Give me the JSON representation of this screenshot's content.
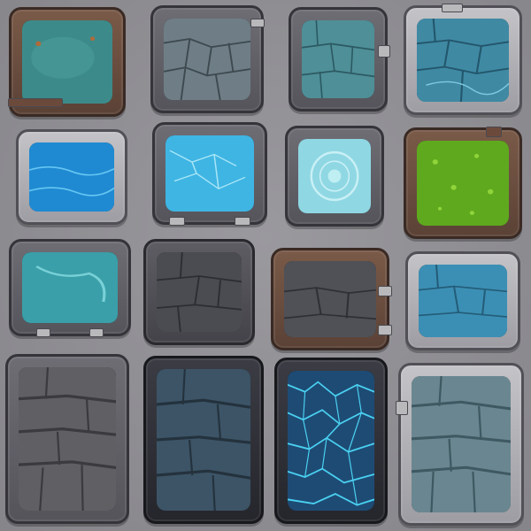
{
  "sheet": {
    "tiles": [
      {
        "id": "t1",
        "frame": "wood",
        "fill": "murky-water",
        "color": "#3c8b8a"
      },
      {
        "id": "t2",
        "frame": "stone",
        "fill": "stone-floor",
        "color": "#6f7e86"
      },
      {
        "id": "t3",
        "frame": "stone",
        "fill": "teal-stone",
        "color": "#4f8f97"
      },
      {
        "id": "t4",
        "frame": "steel",
        "fill": "blue-stone",
        "color": "#3f89a3"
      },
      {
        "id": "t5",
        "frame": "steel",
        "fill": "deep-water",
        "color": "#1f8ad2"
      },
      {
        "id": "t6",
        "frame": "stone",
        "fill": "bright-water",
        "color": "#3fb5e3"
      },
      {
        "id": "t7",
        "frame": "stone",
        "fill": "swirl-water",
        "color": "#8fd7e3"
      },
      {
        "id": "t8",
        "frame": "wood",
        "fill": "acid-slime",
        "color": "#5fa91e"
      },
      {
        "id": "t9",
        "frame": "stone",
        "fill": "teal-water",
        "color": "#3a9fa8"
      },
      {
        "id": "t10",
        "frame": "dark",
        "fill": "dark-stone",
        "color": "#4b4c52"
      },
      {
        "id": "t11",
        "frame": "wood",
        "fill": "charcoal-stone",
        "color": "#505157"
      },
      {
        "id": "t12",
        "frame": "steel",
        "fill": "blue-stone",
        "color": "#3c8fb4"
      },
      {
        "id": "t13",
        "frame": "stone",
        "fill": "gray-cobble",
        "color": "#5f5f64"
      },
      {
        "id": "t14",
        "frame": "black",
        "fill": "slate-cobble",
        "color": "#3c5466"
      },
      {
        "id": "t15",
        "frame": "black",
        "fill": "crackle-water",
        "color": "#1e4b74"
      },
      {
        "id": "t16",
        "frame": "steel",
        "fill": "wet-cobble",
        "color": "#6a8791"
      }
    ],
    "accents": {
      "crack": "#2b6f86",
      "slime_spot": "#8fd43a",
      "glow": "#4fe0ff",
      "rust": "#b06a3a"
    }
  }
}
